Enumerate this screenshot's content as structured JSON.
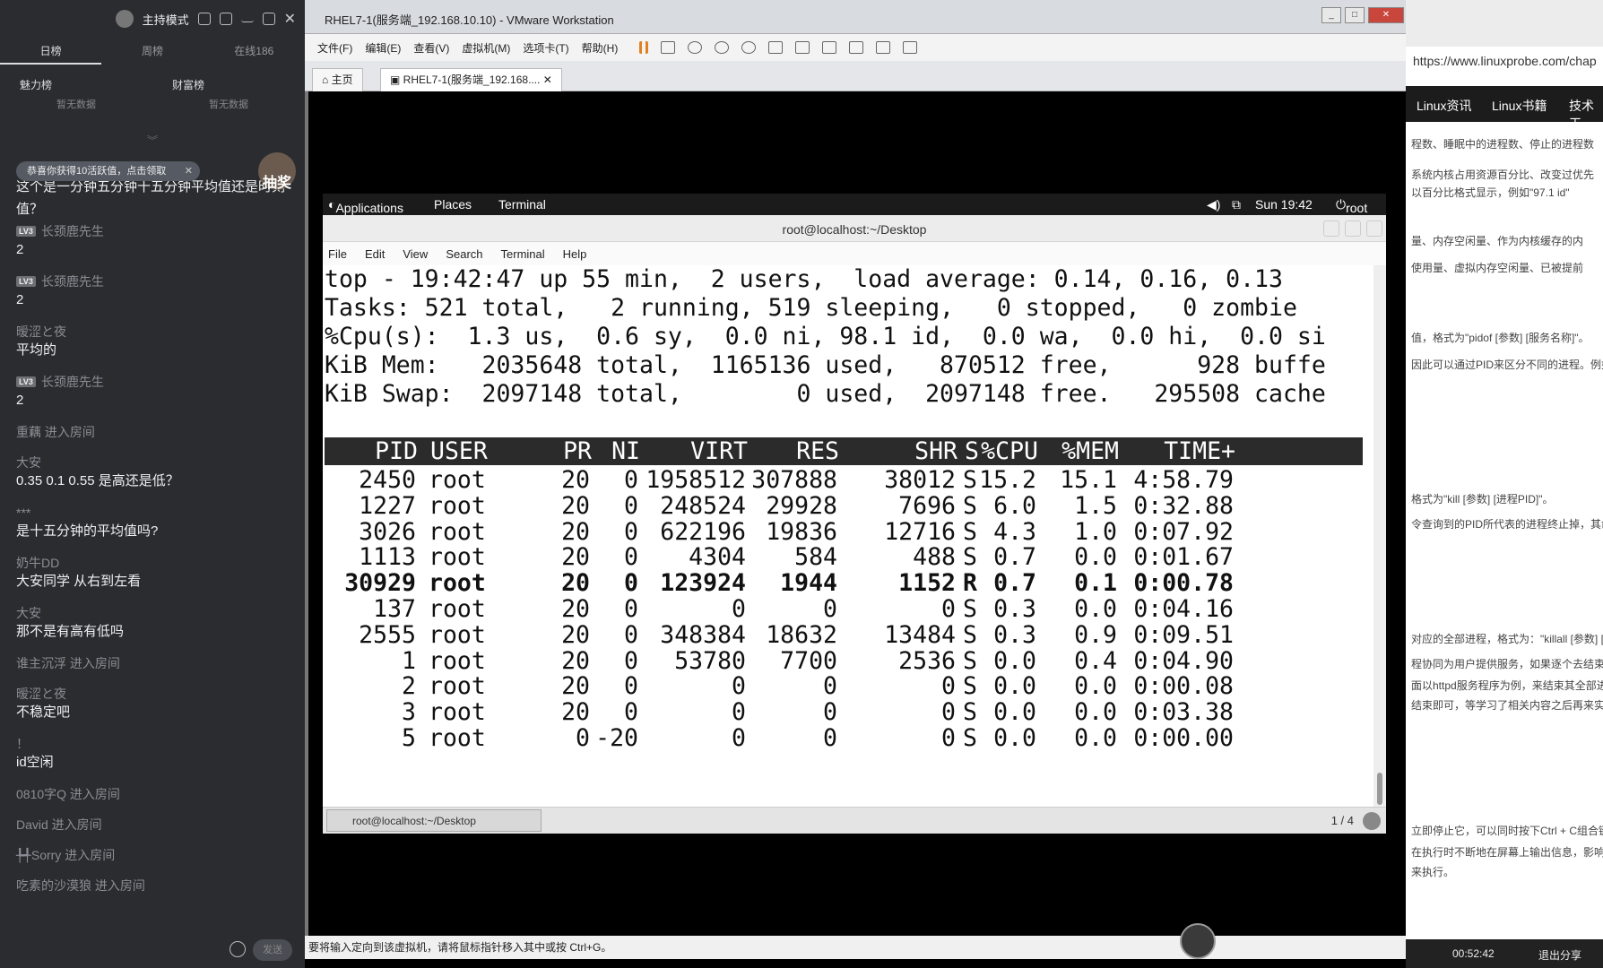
{
  "chat": {
    "mode_label": "主持模式",
    "tabs": [
      "日榜",
      "周榜",
      "在线186"
    ],
    "ranks": [
      "魅力榜",
      "财富榜"
    ],
    "no_data": [
      "暂无数据",
      "暂无数据"
    ],
    "toast": "恭喜你获得10活跃值，点击领取",
    "lottery": "抽奖",
    "question": "这个是一分钟五分钟十五分钟平均值还是时刻值？",
    "messages": [
      {
        "nick": "长颈鹿先生",
        "lv": "LV3",
        "text": "2"
      },
      {
        "nick": "长颈鹿先生",
        "lv": "LV3",
        "text": "2"
      },
      {
        "nick": "暧涩と夜",
        "lv": "",
        "text": "平均的"
      },
      {
        "nick": "长颈鹿先生",
        "lv": "LV3",
        "text": "2"
      },
      {
        "nick": "重藕 进入房间",
        "lv": "",
        "text": ""
      },
      {
        "nick": "大安",
        "lv": "",
        "text": "0.35 0.1 0.55 是高还是低？"
      },
      {
        "nick": "***",
        "lv": "",
        "text": "是十五分钟的平均值吗?"
      },
      {
        "nick": "奶牛DD",
        "lv": "",
        "text": "大安同学 从右到左看"
      },
      {
        "nick": "大安",
        "lv": "",
        "text": "那不是有高有低吗"
      },
      {
        "nick": "谁主沉浮 进入房间",
        "lv": "",
        "text": ""
      },
      {
        "nick": "暧涩と夜",
        "lv": "",
        "text": "不稳定吧"
      },
      {
        "nick": "！",
        "lv": "",
        "text": "id空闲"
      },
      {
        "nick": "0810字Q 进入房间",
        "lv": "",
        "text": ""
      },
      {
        "nick": "David 进入房间",
        "lv": "",
        "text": ""
      },
      {
        "nick": "╄╃Sorry 进入房间",
        "lv": "",
        "text": ""
      },
      {
        "nick": "吃素的沙漠狼 进入房间",
        "lv": "",
        "text": ""
      }
    ],
    "send": "发送"
  },
  "vmware": {
    "title": "RHEL7-1(服务端_192.168.10.10) - VMware Workstation",
    "menu": [
      "文件(F)",
      "编辑(E)",
      "查看(V)",
      "虚拟机(M)",
      "选项卡(T)",
      "帮助(H)"
    ],
    "tabs": [
      "主页",
      "RHEL7-1(服务端_192.168...."
    ],
    "status": "要将输入定向到该虚拟机，请将鼠标指针移入其中或按 Ctrl+G。"
  },
  "gnome": {
    "applications": "Applications",
    "places": "Places",
    "terminal_app": "Terminal",
    "clock": "Sun 19:42",
    "user": "root"
  },
  "terminal": {
    "window_title": "root@localhost:~/Desktop",
    "menu": [
      "File",
      "Edit",
      "View",
      "Search",
      "Terminal",
      "Help"
    ],
    "summary": [
      "top - 19:42:47 up 55 min,  2 users,  load average: 0.14, 0.16, 0.13",
      "Tasks: 521 total,   2 running, 519 sleeping,   0 stopped,   0 zombie",
      "%Cpu(s):  1.3 us,  0.6 sy,  0.0 ni, 98.1 id,  0.0 wa,  0.0 hi,  0.0 si",
      "KiB Mem:   2035648 total,  1165136 used,   870512 free,      928 buffe",
      "KiB Swap:  2097148 total,        0 used,  2097148 free.   295508 cache"
    ],
    "columns": [
      "PID",
      "USER",
      "PR",
      "NI",
      "VIRT",
      "RES",
      "SHR",
      "S",
      "%CPU",
      "%MEM",
      "TIME+"
    ],
    "rows": [
      [
        "2450",
        "root",
        "20",
        "0",
        "1958512",
        "307888",
        "38012",
        "S",
        "15.2",
        "15.1",
        "4:58.79"
      ],
      [
        "1227",
        "root",
        "20",
        "0",
        "248524",
        "29928",
        "7696",
        "S",
        "6.0",
        "1.5",
        "0:32.88"
      ],
      [
        "3026",
        "root",
        "20",
        "0",
        "622196",
        "19836",
        "12716",
        "S",
        "4.3",
        "1.0",
        "0:07.92"
      ],
      [
        "1113",
        "root",
        "20",
        "0",
        "4304",
        "584",
        "488",
        "S",
        "0.7",
        "0.0",
        "0:01.67"
      ],
      [
        "30929",
        "root",
        "20",
        "0",
        "123924",
        "1944",
        "1152",
        "R",
        "0.7",
        "0.1",
        "0:00.78"
      ],
      [
        "137",
        "root",
        "20",
        "0",
        "0",
        "0",
        "0",
        "S",
        "0.3",
        "0.0",
        "0:04.16"
      ],
      [
        "2555",
        "root",
        "20",
        "0",
        "348384",
        "18632",
        "13484",
        "S",
        "0.3",
        "0.9",
        "0:09.51"
      ],
      [
        "1",
        "root",
        "20",
        "0",
        "53780",
        "7700",
        "2536",
        "S",
        "0.0",
        "0.4",
        "0:04.90"
      ],
      [
        "2",
        "root",
        "20",
        "0",
        "0",
        "0",
        "0",
        "S",
        "0.0",
        "0.0",
        "0:00.08"
      ],
      [
        "3",
        "root",
        "20",
        "0",
        "0",
        "0",
        "0",
        "S",
        "0.0",
        "0.0",
        "0:03.38"
      ],
      [
        "5",
        "root",
        "0",
        "-20",
        "0",
        "0",
        "0",
        "S",
        "0.0",
        "0.0",
        "0:00.00"
      ]
    ],
    "bold_row_index": 4,
    "taskbar_item": "root@localhost:~/Desktop",
    "pager": "1 / 4"
  },
  "browser": {
    "address": "https://www.linuxprobe.com/chap",
    "nav": [
      "Linux资讯",
      "Linux书籍",
      "技术干"
    ],
    "snippets": [
      "程数、睡眠中的进程数、停止的进程数",
      "系统内核占用资源百分比、改变过优先",
      "以百分比格式显示，例如\"97.1 id\"",
      "量、内存空闲量、作为内核缓存的内",
      "使用量、虚拟内存空闲量、已被提前",
      "值，格式为\"pidof [参数] [服务名称]\"。",
      "因此可以通过PID来区分不同的进程。例如",
      "格式为\"kill [参数] [进程PID]\"。",
      "令查询到的PID所代表的进程终止掉，其命",
      "对应的全部进程，格式为：\"killall [参数] [",
      "程协同为用户提供服务，如果逐个去结束",
      "面以httpd服务程序为例，来结束其全部进",
      "结束即可，等学习了相关内容之后再来实践。",
      "立即停止它，可以同时按下Ctrl + C组合键",
      "在执行时不断地在屏幕上输出信息，影响",
      "来执行。"
    ],
    "time": "00:52:42",
    "exit": "退出分享"
  }
}
